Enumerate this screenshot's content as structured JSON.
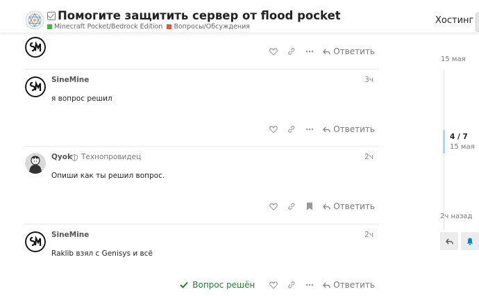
{
  "header": {
    "title": "Помогите защитить сервер от flood pocket",
    "categories": [
      {
        "label": "Minecraft Pocket/Bedrock Edition",
        "color": "#3ab54a"
      },
      {
        "label": "Вопросы/Обсуждения",
        "color": "#e45735"
      }
    ],
    "nav_link": "Хостинг"
  },
  "actions": {
    "reply_label": "Ответить",
    "solved_label": "Вопрос решён"
  },
  "posts": [
    {
      "username": "",
      "time": "",
      "body": ""
    },
    {
      "username": "SineMine",
      "time": "3ч",
      "body": "я вопрос решил"
    },
    {
      "username": "Qyok",
      "user_title": "Технопровидец",
      "time": "2ч",
      "body": "Опиши как ты решил вопрос."
    },
    {
      "username": "SineMine",
      "time": "2ч",
      "body": "Raklib взял с Genisys и всё"
    }
  ],
  "timeline": {
    "start_date": "15 мая",
    "position": "4 / 7",
    "position_date": "15 мая",
    "end_label": "2ч назад"
  },
  "colors": {
    "accent": "#0088cc",
    "solved": "#1e7e34",
    "muted": "#777777"
  }
}
